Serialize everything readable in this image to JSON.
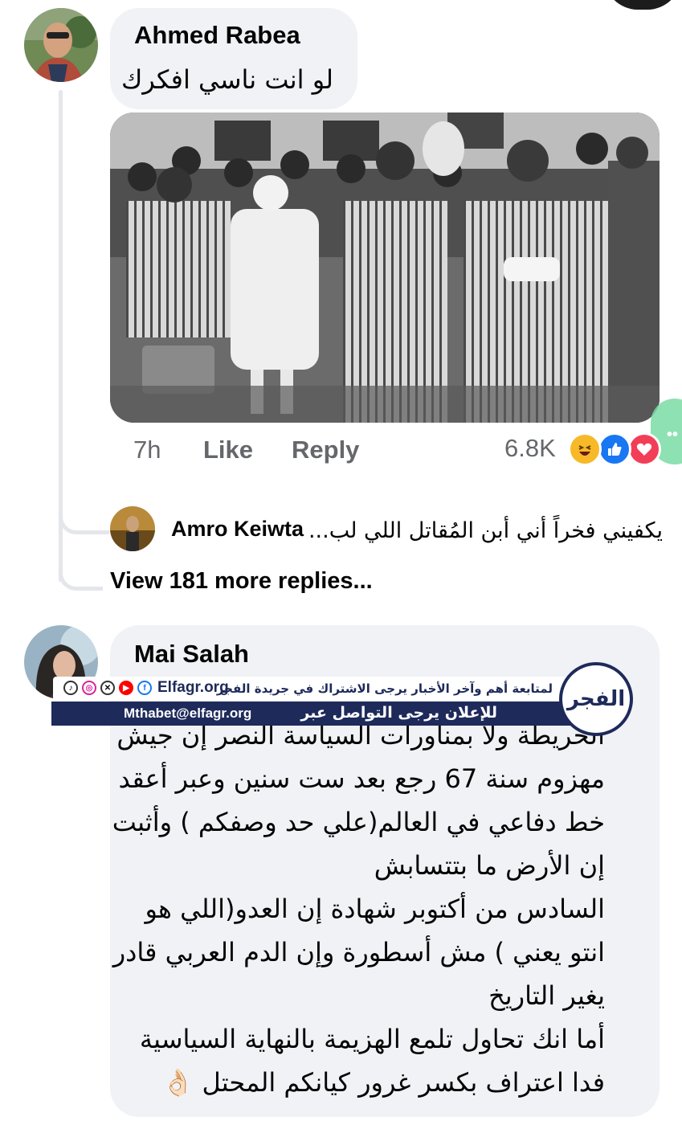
{
  "comments": [
    {
      "author": "Ahmed Rabea",
      "text": "لو انت ناسي افكرك",
      "meta": {
        "time": "7h",
        "like_label": "Like",
        "reply_label": "Reply",
        "reaction_count": "6.8K",
        "reactions": [
          "haha-reaction-icon",
          "like-reaction-icon",
          "love-reaction-icon"
        ]
      }
    },
    {
      "author": "Mai Salah",
      "text_lines": [
        "الخريطة ولا بمناورات السياسة النصر إن جيش",
        "مهزوم سنة 67 رجع بعد ست سنين وعبر أعقد",
        "خط دفاعي في العالم(علي حد وصفكم ) وأثبت",
        "إن الأرض ما بتتسابش",
        "السادس من أكتوبر شهادة إن العدو(اللي هو",
        "انتو يعني ) مش أسطورة وإن الدم العربي قادر",
        "يغير التاريخ",
        "أما انك تحاول تلمع الهزيمة بالنهاية السياسية",
        "فدا اعتراف بكسر غرور كيانكم المحتل 👌🏻"
      ]
    }
  ],
  "reply_preview": {
    "author": "Amro Keiwta",
    "text": "يكفيني فخراً أني أبن المُقاتل اللي لب..."
  },
  "view_more_label": "View 181 more replies...",
  "overlay": {
    "site": "Elfagr.org",
    "follow_text": "لمتابعة أهم وآخر الأخبار يرجى الاشتراك في جريدة الفجر",
    "ad_text": "للإعلان يرجى التواصل عبر",
    "email": "Mthabet@elfagr.org",
    "logo_text": "الفجر"
  },
  "colors": {
    "bubble": "#f0f2f5",
    "meta_gray": "#65676b",
    "banner_navy": "#1e2a5a",
    "like_blue": "#1877f2",
    "love_red": "#f33e58",
    "haha_yellow": "#f7b928"
  }
}
